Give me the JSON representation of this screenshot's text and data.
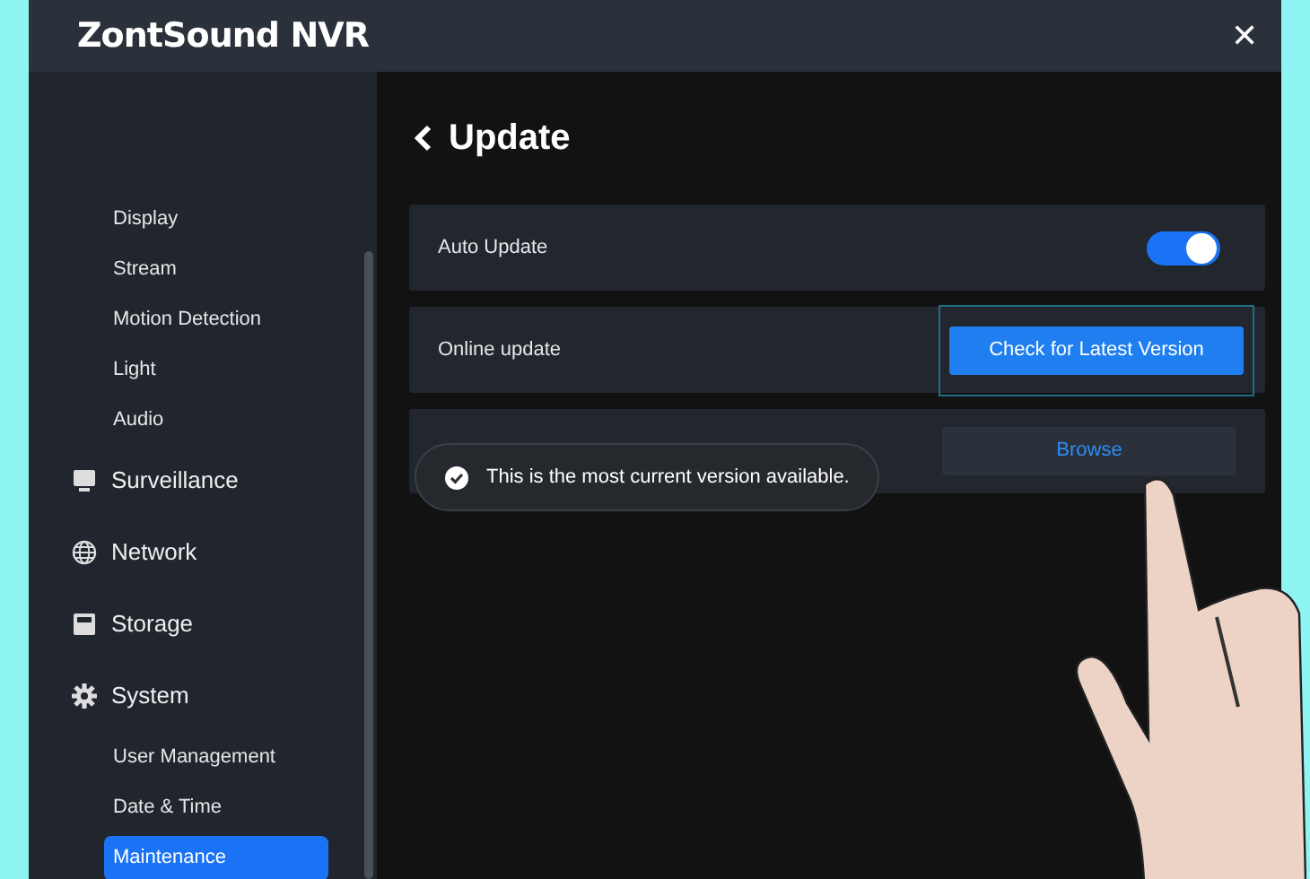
{
  "window": {
    "title": "ZontSound NVR",
    "close": "✕"
  },
  "sidebar": {
    "items": [
      {
        "kind": "sub",
        "label": "Display",
        "selected": false
      },
      {
        "kind": "sub",
        "label": "Stream",
        "selected": false
      },
      {
        "kind": "sub",
        "label": "Motion Detection",
        "selected": false
      },
      {
        "kind": "sub",
        "label": "Light",
        "selected": false
      },
      {
        "kind": "sub",
        "label": "Audio",
        "selected": false
      },
      {
        "kind": "section",
        "label": "Surveillance"
      },
      {
        "kind": "section",
        "label": "Network"
      },
      {
        "kind": "section",
        "label": "Storage"
      },
      {
        "kind": "section",
        "label": "System"
      },
      {
        "kind": "sub",
        "label": "User Management",
        "selected": false
      },
      {
        "kind": "sub",
        "label": "Date & Time",
        "selected": false
      },
      {
        "kind": "sub",
        "label": "Maintenance",
        "selected": true
      }
    ]
  },
  "page": {
    "title": "Update",
    "rows": [
      {
        "kind": "toggle",
        "label": "Auto Update",
        "on": true
      },
      {
        "kind": "button",
        "label": "Online update",
        "button": "Check for Latest Version",
        "primary": true
      },
      {
        "kind": "button",
        "button": "Browse",
        "primary": false
      }
    ]
  },
  "toast": {
    "text": "This is the most current version available."
  }
}
